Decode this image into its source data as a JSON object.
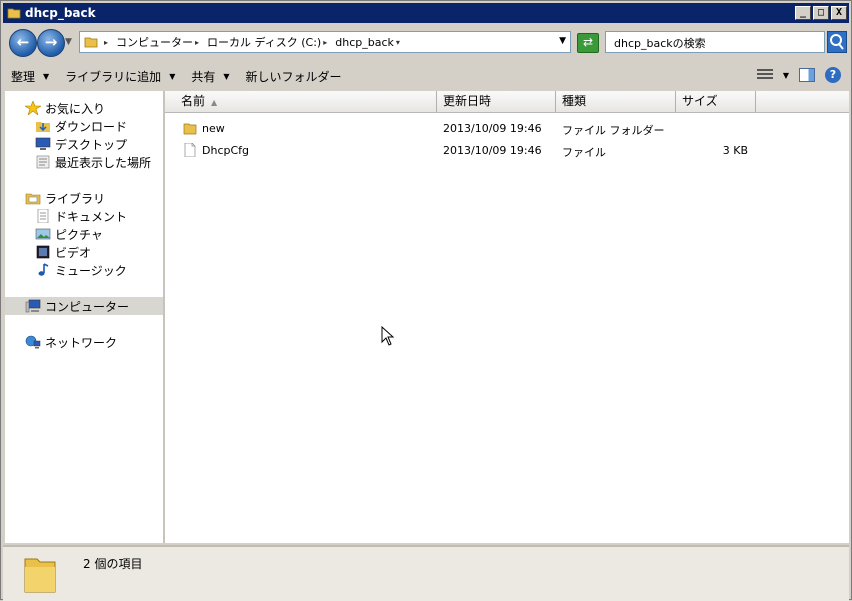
{
  "window": {
    "title": "dhcp_back",
    "min": "_",
    "max": "□",
    "close": "X"
  },
  "nav": {
    "back": "←",
    "forward": "→"
  },
  "address": {
    "crumbs": [
      {
        "label": "コンピューター"
      },
      {
        "label": "ローカル ディスク (C:)"
      },
      {
        "label": "dhcp_back"
      }
    ]
  },
  "search": {
    "placeholder": "dhcp_backの検索"
  },
  "toolbar": {
    "organize": "整理",
    "add_to_library": "ライブラリに追加",
    "share": "共有",
    "new_folder": "新しいフォルダー",
    "help": "?"
  },
  "sidebar": {
    "favorites": {
      "label": "お気に入り",
      "items": [
        "ダウンロード",
        "デスクトップ",
        "最近表示した場所"
      ]
    },
    "libraries": {
      "label": "ライブラリ",
      "items": [
        "ドキュメント",
        "ピクチャ",
        "ビデオ",
        "ミュージック"
      ]
    },
    "computer": "コンピューター",
    "network": "ネットワーク"
  },
  "columns": {
    "name": "名前",
    "modified": "更新日時",
    "type": "種類",
    "size": "サイズ"
  },
  "files": [
    {
      "name": "new",
      "modified": "2013/10/09 19:46",
      "type": "ファイル フォルダー",
      "size": "",
      "icon": "folder-icon"
    },
    {
      "name": "DhcpCfg",
      "modified": "2013/10/09 19:46",
      "type": "ファイル",
      "size": "3 KB",
      "icon": "file-icon"
    }
  ],
  "status": {
    "text": "2 個の項目"
  },
  "colors": {
    "titlebar": "#0a246a",
    "chrome": "#d4d0c8",
    "folder": "#e8c04a"
  }
}
